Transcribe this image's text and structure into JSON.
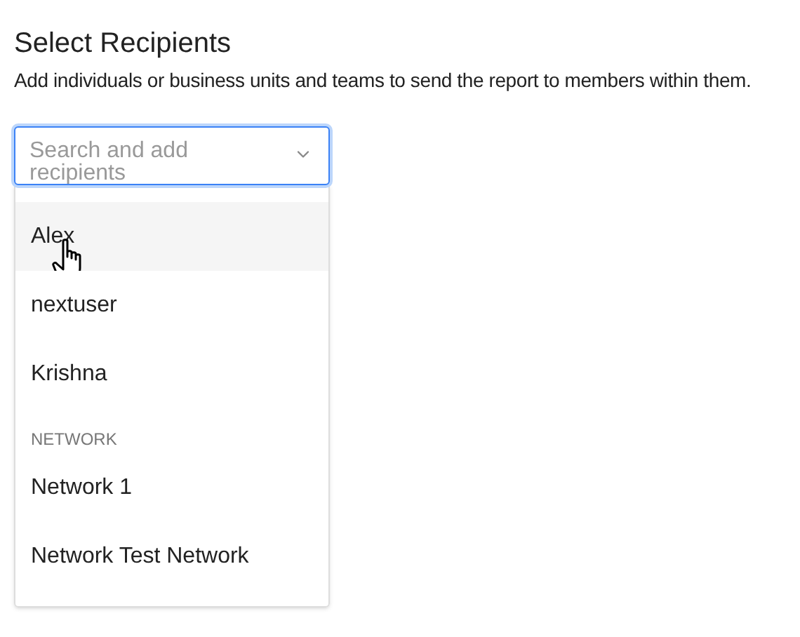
{
  "title": "Select Recipients",
  "description": "Add individuals or business units and teams to send the report to members within them.",
  "search": {
    "placeholder": "Search and add recipients",
    "focused": true
  },
  "options": [
    {
      "kind": "option",
      "label": "Alex",
      "hovered": true
    },
    {
      "kind": "option",
      "label": "nextuser",
      "hovered": false
    },
    {
      "kind": "option",
      "label": "Krishna",
      "hovered": false
    },
    {
      "kind": "header",
      "label": "NETWORK"
    },
    {
      "kind": "option",
      "label": "Network 1",
      "hovered": false
    },
    {
      "kind": "option",
      "label": "Network Test Network",
      "hovered": false
    }
  ]
}
